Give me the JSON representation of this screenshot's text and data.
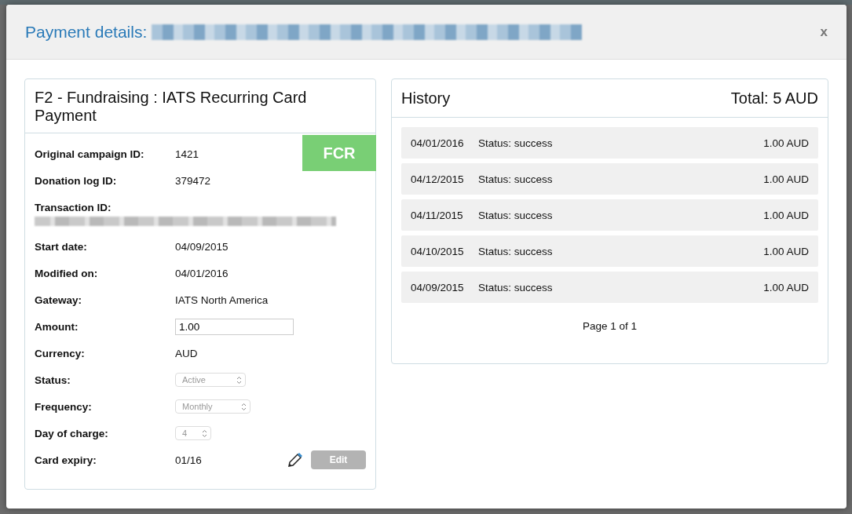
{
  "modal": {
    "title": "Payment details:",
    "close": "x"
  },
  "payment": {
    "title": "F2 - Fundraising : IATS Recurring Card Payment",
    "badge": "FCR",
    "fields": [
      {
        "kind": "text",
        "label": "Original campaign ID:",
        "value": "1421"
      },
      {
        "kind": "text",
        "label": "Donation log ID:",
        "value": "379472"
      },
      {
        "kind": "redacted",
        "label": "Transaction ID:"
      },
      {
        "kind": "text",
        "label": "Start date:",
        "value": "04/09/2015"
      },
      {
        "kind": "text",
        "label": "Modified on:",
        "value": "04/01/2016"
      },
      {
        "kind": "text",
        "label": "Gateway:",
        "value": "IATS North America"
      },
      {
        "kind": "input",
        "label": "Amount:",
        "value": "1.00"
      },
      {
        "kind": "text",
        "label": "Currency:",
        "value": "AUD"
      },
      {
        "kind": "select",
        "label": "Status:",
        "value": "Active",
        "disabled": true
      },
      {
        "kind": "select",
        "label": "Frequency:",
        "value": "Monthly",
        "disabled": true
      },
      {
        "kind": "select",
        "label": "Day of charge:",
        "value": "4",
        "disabled": true
      },
      {
        "kind": "edit",
        "label": "Card expiry:",
        "value": "01/16",
        "button": "Edit",
        "disabled": true
      }
    ]
  },
  "history": {
    "title": "History",
    "total": "Total: 5 AUD",
    "rows": [
      {
        "date": "04/01/2016",
        "status": "Status: success",
        "amount": "1.00 AUD"
      },
      {
        "date": "04/12/2015",
        "status": "Status: success",
        "amount": "1.00 AUD"
      },
      {
        "date": "04/11/2015",
        "status": "Status: success",
        "amount": "1.00 AUD"
      },
      {
        "date": "04/10/2015",
        "status": "Status: success",
        "amount": "1.00 AUD"
      },
      {
        "date": "04/09/2015",
        "status": "Status: success",
        "amount": "1.00 AUD"
      }
    ],
    "pager": "Page 1 of 1"
  }
}
